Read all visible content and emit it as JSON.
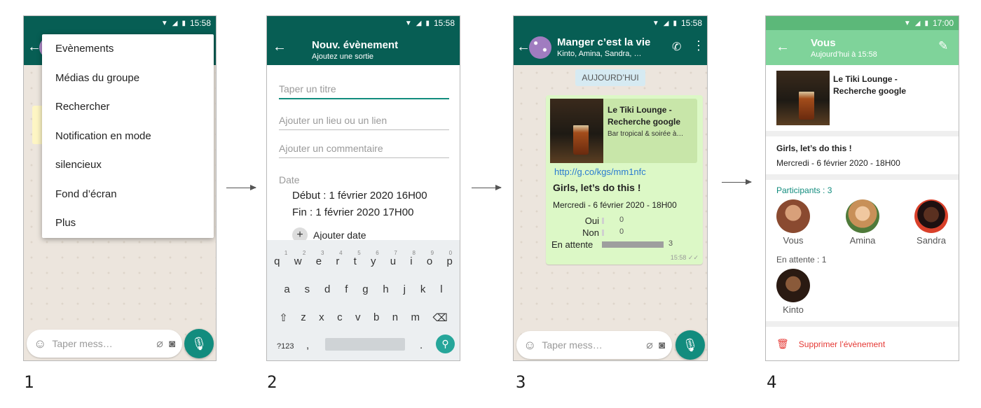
{
  "status": {
    "time_1": "15:58",
    "time_2": "15:58",
    "time_3": "15:58",
    "time_4": "17:00"
  },
  "steps": [
    "1",
    "2",
    "3",
    "4"
  ],
  "screen1": {
    "menu_items": [
      "Evènements",
      "Médias du groupe",
      "Rechercher",
      "Notification en mode",
      "silencieux",
      "Fond d’écran",
      "Plus"
    ],
    "input_placeholder": "Taper mess…",
    "icons": [
      "back-arrow-icon",
      "emoji-icon",
      "attach-icon",
      "camera-icon",
      "mic-icon"
    ]
  },
  "screen2": {
    "title": "Nouv. évènement",
    "subtitle": "Ajoutez une sortie",
    "title_placeholder": "Taper un titre",
    "place_placeholder": "Ajouter un lieu ou un lien",
    "comment_placeholder": "Ajouter un commentaire",
    "date_label": "Date",
    "start": "Début : 1 février 2020 16H00",
    "end": "Fin  : 1 février 2020 17H00",
    "add_date": "Ajouter date",
    "keyboard": {
      "row1": [
        "q",
        "w",
        "e",
        "r",
        "t",
        "y",
        "u",
        "i",
        "o",
        "p"
      ],
      "row1_hints": [
        "1",
        "2",
        "3",
        "4",
        "5",
        "6",
        "7",
        "8",
        "9",
        "0"
      ],
      "row2": [
        "a",
        "s",
        "d",
        "f",
        "g",
        "h",
        "j",
        "k",
        "l"
      ],
      "row3": [
        "z",
        "x",
        "c",
        "v",
        "b",
        "n",
        "m"
      ],
      "sym": "?123",
      "comma": ",",
      "period": "."
    }
  },
  "screen3": {
    "title": "Manger c’est la vie",
    "subtitle": "Kinto, Amina, Sandra, …",
    "date_chip": "AUJOURD’HUI",
    "link_title": "Le Tiki Lounge - Recherche google",
    "link_desc": "Bar tropical & soirée à…",
    "url": "http://g.co/kgs/mm1nfc",
    "event_title": "Girls, let’s do this !",
    "event_date": "Mercredi - 6 février 2020 - 18H00",
    "poll": [
      {
        "label": "Oui",
        "count": "0",
        "fraction": 0
      },
      {
        "label": "Non",
        "count": "0",
        "fraction": 0
      },
      {
        "label": "En attente",
        "count": "3",
        "fraction": 1
      }
    ],
    "time": "15:58",
    "input_placeholder": "Taper mess…"
  },
  "screen4": {
    "title": "Vous",
    "subtitle": "Aujourd’hui à 15:58",
    "link_title": "Le Tiki Lounge - Recherche google",
    "event_title": "Girls, let’s do this !",
    "event_date": "Mercredi - 6 février 2020 - 18H00",
    "participants_label": "Participants : 3",
    "participants": [
      "Vous",
      "Amina",
      "Sandra"
    ],
    "pending_label": "En attente : 1",
    "pending": [
      "Kinto"
    ],
    "delete": "Supprimer l’évènement",
    "accent": "#128c7e",
    "appbar_color": "#7fd39a",
    "delete_color": "#e53935"
  }
}
